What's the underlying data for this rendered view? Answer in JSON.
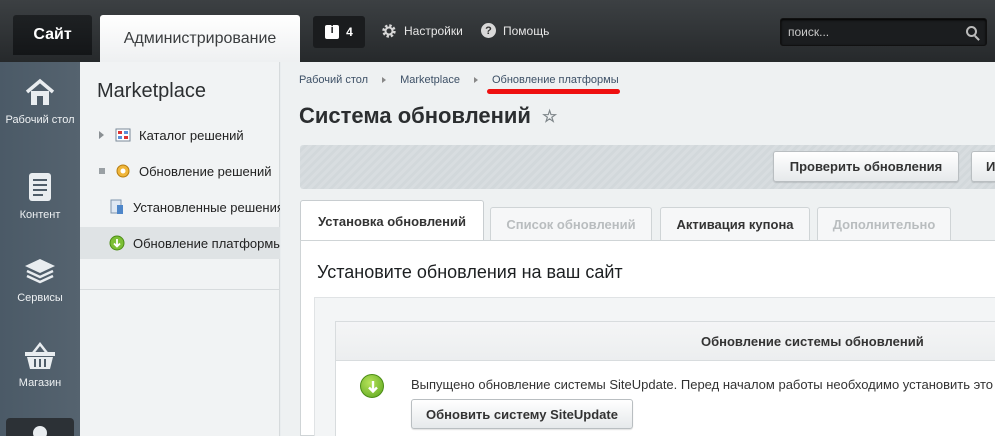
{
  "topbar": {
    "site_tab": "Сайт",
    "admin_tab": "Администрирование",
    "notifications_count": "4",
    "settings_label": "Настройки",
    "help_label": "Помощь",
    "search_placeholder": "поиск..."
  },
  "leftmenu": {
    "items": [
      {
        "label": "Рабочий стол",
        "icon": "home-icon"
      },
      {
        "label": "Контент",
        "icon": "document-icon"
      },
      {
        "label": "Сервисы",
        "icon": "layers-icon"
      },
      {
        "label": "Магазин",
        "icon": "basket-icon"
      }
    ]
  },
  "sidebar": {
    "title": "Marketplace",
    "items": [
      {
        "label": "Каталог решений",
        "icon": "catalog-icon",
        "expandable": true
      },
      {
        "label": "Обновление решений",
        "icon": "gear-update-icon",
        "expandable": false
      },
      {
        "label": "Установленные решения",
        "icon": "installed-icon",
        "expandable": false
      },
      {
        "label": "Обновление платформы",
        "icon": "platform-update-icon",
        "expandable": false,
        "active": true
      }
    ]
  },
  "breadcrumb": [
    "Рабочий стол",
    "Marketplace",
    "Обновление платформы"
  ],
  "page": {
    "title": "Система обновлений",
    "toolbar": {
      "check_button": "Проверить обновления",
      "second_button": "И"
    },
    "tabs": [
      {
        "label": "Установка обновлений",
        "state": "selected"
      },
      {
        "label": "Список обновлений",
        "state": "disabled"
      },
      {
        "label": "Активация купона",
        "state": "normal"
      },
      {
        "label": "Дополнительно",
        "state": "disabled"
      }
    ],
    "panel_title": "Установите обновления на ваш сайт",
    "section_header": "Обновление системы обновлений",
    "message": "Выпущено обновление системы SiteUpdate. Перед началом работы необходимо установить это о",
    "update_button": "Обновить систему SiteUpdate"
  },
  "colors": {
    "accent_red_underline": "#ee1010",
    "topbar_dark": "#26292b",
    "leftmenu_bg": "#4b5a67"
  }
}
